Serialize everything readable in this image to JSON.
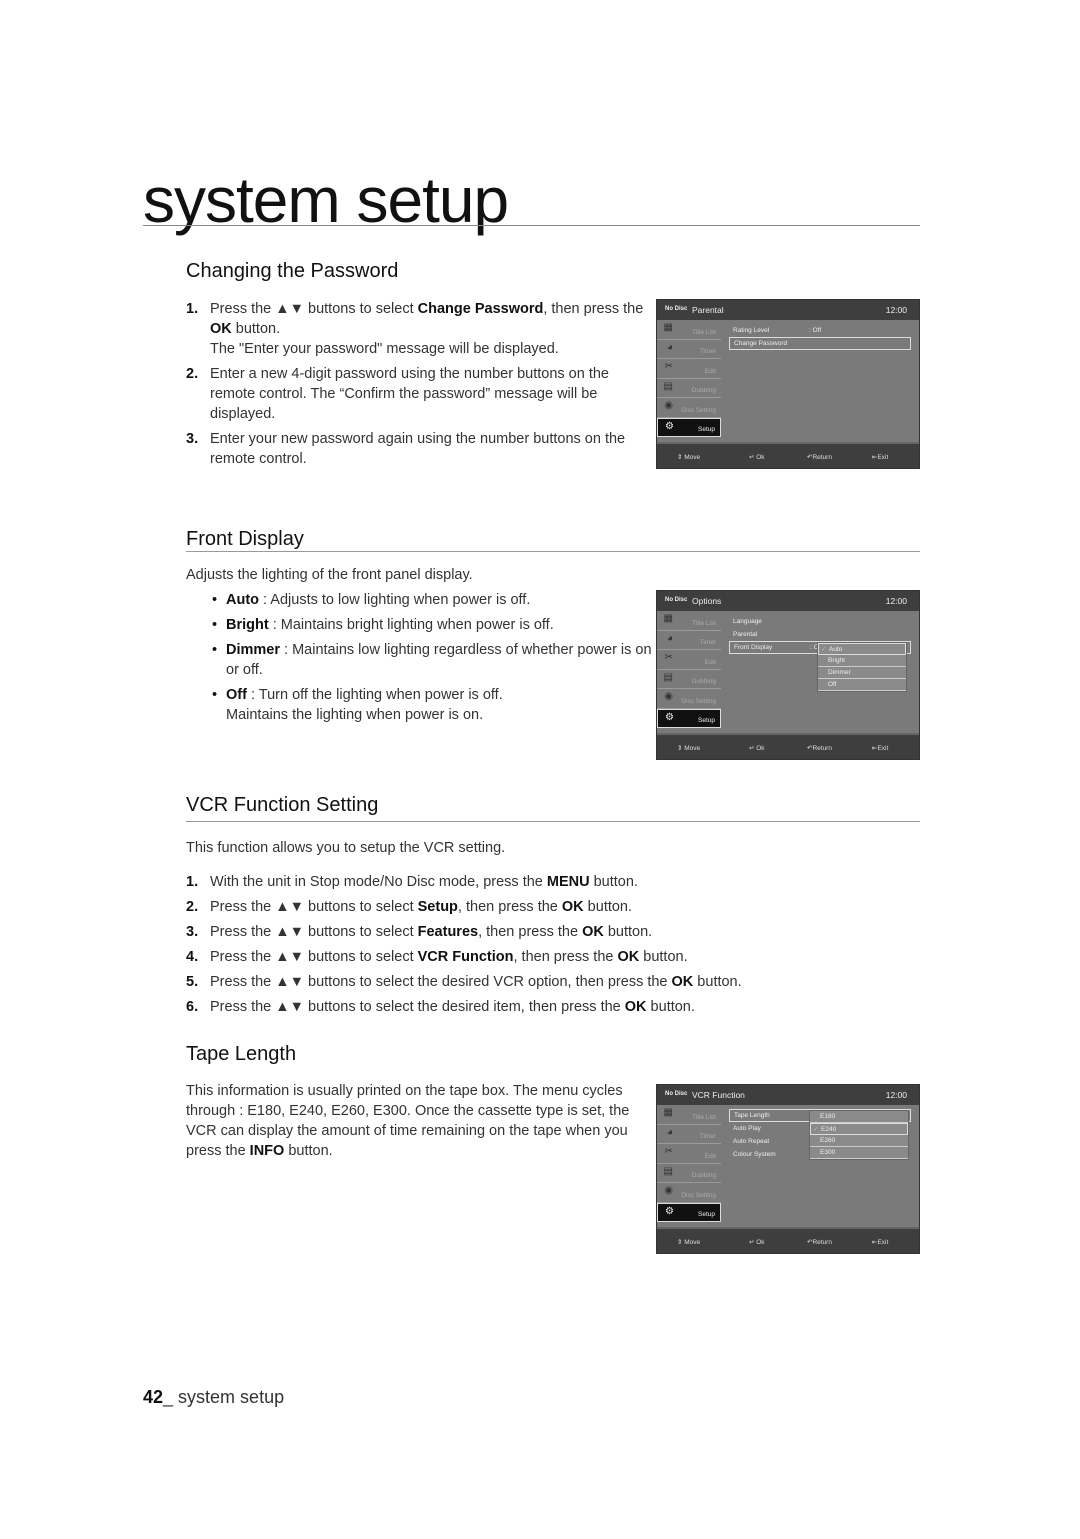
{
  "chapter": {
    "title": "system setup"
  },
  "sections": {
    "password": {
      "heading": "Changing the Password",
      "steps": [
        {
          "num": "1.",
          "parts": [
            "Press the ▲▼ buttons to select ",
            "Change Password",
            ", then press the ",
            "OK",
            " button."
          ],
          "note": "The \"Enter your password\" message will be displayed."
        },
        {
          "num": "2.",
          "text": "Enter a new 4-digit password using the number buttons on the remote control. The “Confirm the password” message will be displayed."
        },
        {
          "num": "3.",
          "text": "Enter your new password again using the number buttons on the remote control."
        }
      ]
    },
    "front_display": {
      "heading": "Front Display",
      "intro": "Adjusts the lighting of the front panel display.",
      "bullets": [
        {
          "term": "Auto",
          "desc": " : Adjusts to low lighting when power is off."
        },
        {
          "term": "Bright",
          "desc": " : Maintains bright lighting when power is off."
        },
        {
          "term": "Dimmer",
          "desc": " : Maintains low lighting regardless of whether power is on or off."
        },
        {
          "term": "Off",
          "desc": " : Turn off the lighting when power is off.",
          "note": "Maintains the lighting when power is on."
        }
      ]
    },
    "vcr": {
      "heading": "VCR Function Setting",
      "intro": "This function allows you to setup the VCR setting.",
      "steps": [
        {
          "num": "1.",
          "a": "With the unit in Stop mode/No Disc mode, press the ",
          "b": "MENU",
          "c": " button.",
          "d": "",
          "e": ""
        },
        {
          "num": "2.",
          "a": "Press the ▲▼ buttons to select ",
          "b": "Setup",
          "c": ", then press the ",
          "d": "OK",
          "e": " button."
        },
        {
          "num": "3.",
          "a": "Press the ▲▼ buttons to select ",
          "b": "Features",
          "c": ", then press the ",
          "d": "OK",
          "e": " button."
        },
        {
          "num": "4.",
          "a": "Press the ▲▼ buttons to select ",
          "b": "VCR Function",
          "c": ", then press the ",
          "d": "OK",
          "e": " button."
        },
        {
          "num": "5.",
          "a": "Press the ▲▼ buttons to select the desired VCR option, then press the ",
          "b": "OK",
          "c": " button.",
          "d": "",
          "e": ""
        },
        {
          "num": "6.",
          "a": "Press the ▲▼ buttons to select the desired item, then press the ",
          "b": "OK",
          "c": " button.",
          "d": "",
          "e": ""
        }
      ]
    },
    "tape": {
      "heading": "Tape Length",
      "text_a": "This information is usually printed on the tape box. The menu cycles through : E180, E240, E260, E300. Once the cassette type is set, the VCR can display the amount of time remaining on the tape when you press the ",
      "text_b": "INFO",
      "text_c": " button."
    }
  },
  "tv_common": {
    "no_disc": "No Disc",
    "time": "12:00",
    "sidebar": [
      {
        "label": "Title List",
        "icon": "film-icon",
        "glyph": "▦"
      },
      {
        "label": "Timer",
        "icon": "timer-icon",
        "glyph": "◕"
      },
      {
        "label": "Edit",
        "icon": "scissors-icon",
        "glyph": "✂"
      },
      {
        "label": "Dubbing",
        "icon": "dubbing-icon",
        "glyph": "▤"
      },
      {
        "label": "Disc Setting",
        "icon": "disc-icon",
        "glyph": "◉"
      },
      {
        "label": "Setup",
        "icon": "gear-icon",
        "glyph": "⚙"
      }
    ],
    "footer": {
      "move": "⇕ Move",
      "ok": "↵ Ok",
      "return": "↶Return",
      "exit": "⇤Exit"
    }
  },
  "screens": {
    "parental": {
      "title": "Parental",
      "rows": [
        {
          "label": "Rating Level",
          "value": ": Off"
        },
        {
          "label": "Change Password",
          "value": ""
        }
      ]
    },
    "options": {
      "title": "Options",
      "rows": [
        {
          "label": "Language",
          "value": ""
        },
        {
          "label": "Parental",
          "value": ""
        },
        {
          "label": "Front Display",
          "value": ": O"
        }
      ],
      "dropdown": [
        {
          "label": "Auto",
          "checked": true
        },
        {
          "label": "Bright"
        },
        {
          "label": "Dimmer"
        },
        {
          "label": "Off"
        }
      ]
    },
    "vcr": {
      "title": "VCR Function",
      "rows": [
        {
          "label": "Tape Length"
        },
        {
          "label": "Auto Play"
        },
        {
          "label": "Auto Repeat"
        },
        {
          "label": "Colour System"
        }
      ],
      "dropdown": [
        {
          "label": "E180"
        },
        {
          "label": "E240",
          "checked": true
        },
        {
          "label": "E260"
        },
        {
          "label": "E300"
        }
      ]
    }
  },
  "footer": {
    "page": "42",
    "sep": "_ ",
    "label": "system setup"
  }
}
